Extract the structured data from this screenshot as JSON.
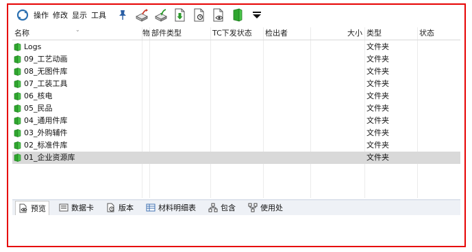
{
  "toolbar": {
    "menus": [
      "操作",
      "修改",
      "显示",
      "工具"
    ],
    "icons": [
      "refresh-icon",
      "pin-icon",
      "check-out-icon",
      "check-in-icon",
      "download-icon",
      "view-doc-icon",
      "preview-doc-icon",
      "green-folder-icon",
      "dropdown-arrow-icon"
    ]
  },
  "columns": [
    "名称",
    "物",
    "部件类型",
    "TC下发状态",
    "检出者",
    "大小",
    "类型",
    "状态"
  ],
  "rows": [
    {
      "name": "Logs",
      "type": "文件夹"
    },
    {
      "name": "09_工艺动画",
      "type": "文件夹"
    },
    {
      "name": "08_无图件库",
      "type": "文件夹"
    },
    {
      "name": "07_工装工具",
      "type": "文件夹"
    },
    {
      "name": "06_核电",
      "type": "文件夹"
    },
    {
      "name": "05_民品",
      "type": "文件夹"
    },
    {
      "name": "04_通用件库",
      "type": "文件夹"
    },
    {
      "name": "03_外购辅件",
      "type": "文件夹"
    },
    {
      "name": "02_标准件库",
      "type": "文件夹"
    },
    {
      "name": "01_企业资源库",
      "type": "文件夹",
      "selected": true
    }
  ],
  "tabs": [
    {
      "label": "预览",
      "icon": "preview-icon",
      "active": true
    },
    {
      "label": "数据卡",
      "icon": "datacard-icon"
    },
    {
      "label": "版本",
      "icon": "version-icon"
    },
    {
      "label": "材料明细表",
      "icon": "bom-table-icon"
    },
    {
      "label": "包含",
      "icon": "contains-icon"
    },
    {
      "label": "使用处",
      "icon": "where-used-icon"
    }
  ],
  "colors": {
    "frame": "#e60000",
    "folder": "#2fa52f",
    "selected_row": "#d9d9d9"
  }
}
